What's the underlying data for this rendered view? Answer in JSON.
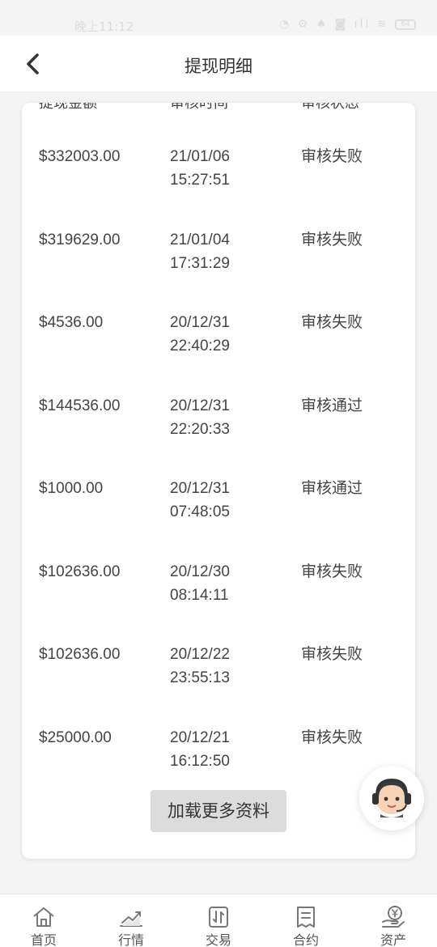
{
  "status_bar": {
    "time": "晚上11:12",
    "battery": "64"
  },
  "header": {
    "title": "提现明细"
  },
  "table": {
    "columns": [
      "提现金额",
      "审核时间",
      "审核状态"
    ],
    "rows": [
      {
        "amount": "$332003.00",
        "date": "21/01/06",
        "time": "15:27:51",
        "status": "审核失败"
      },
      {
        "amount": "$319629.00",
        "date": "21/01/04",
        "time": "17:31:29",
        "status": "审核失败"
      },
      {
        "amount": "$4536.00",
        "date": "20/12/31",
        "time": "22:40:29",
        "status": "审核失败"
      },
      {
        "amount": "$144536.00",
        "date": "20/12/31",
        "time": "22:20:33",
        "status": "审核通过"
      },
      {
        "amount": "$1000.00",
        "date": "20/12/31",
        "time": "07:48:05",
        "status": "审核通过"
      },
      {
        "amount": "$102636.00",
        "date": "20/12/30",
        "time": "08:14:11",
        "status": "审核失败"
      },
      {
        "amount": "$102636.00",
        "date": "20/12/22",
        "time": "23:55:13",
        "status": "审核失败"
      },
      {
        "amount": "$25000.00",
        "date": "20/12/21",
        "time": "16:12:50",
        "status": "审核失败"
      }
    ]
  },
  "load_more_label": "加载更多资料",
  "bottom_nav": [
    {
      "label": "首页",
      "icon": "home-icon"
    },
    {
      "label": "行情",
      "icon": "chart-icon"
    },
    {
      "label": "交易",
      "icon": "trade-icon"
    },
    {
      "label": "合约",
      "icon": "contract-icon"
    },
    {
      "label": "资产",
      "icon": "assets-icon"
    }
  ],
  "colors": {
    "background": "#f4f4f4",
    "card": "#ffffff",
    "text": "#444444",
    "button": "#dcdcdc"
  }
}
